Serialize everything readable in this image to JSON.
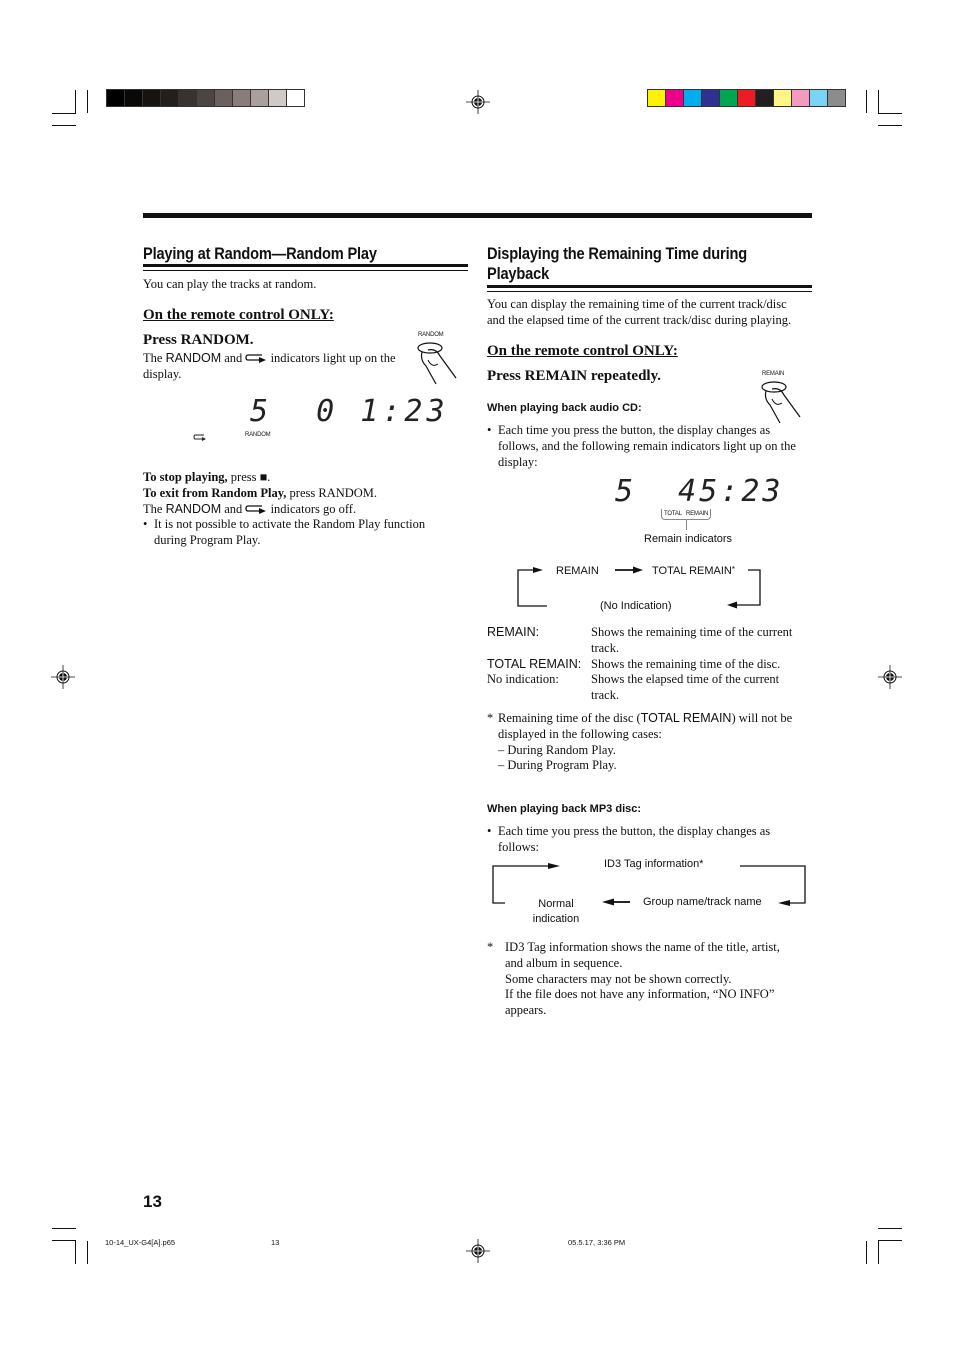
{
  "registration": {
    "grayscale_swatches": [
      "#000000",
      "#0b0908",
      "#161311",
      "#231f1c",
      "#3a3230",
      "#4d4544",
      "#6a605d",
      "#877d7b",
      "#a9a09e",
      "#d1c9c7",
      "#ffffff"
    ],
    "color_swatches": [
      "#fff200",
      "#ec008c",
      "#00aeef",
      "#2e3192",
      "#00a651",
      "#ed1c24",
      "#231f20",
      "#fff685",
      "#f49ac1",
      "#7dd3f7",
      "#8c8c8c"
    ]
  },
  "left": {
    "title": "Playing at Random—Random Play",
    "intro": "You can play the tracks at random.",
    "remote_heading": "On the remote control ONLY:",
    "step_title": "Press RANDOM.",
    "step_text_pre": "The ",
    "step_text_ind": "RANDOM",
    "step_text_mid": " and ",
    "step_text_post": " indicators light up on the",
    "step_text_line2": "display.",
    "button_label": "RANDOM",
    "lcd_text": "5  0 1:23",
    "lcd_indicator": "RANDOM",
    "stop_bold": "To stop playing,",
    "stop_rest": " press ■.",
    "exit_bold": "To exit from Random Play,",
    "exit_rest": " press RANDOM.",
    "off_pre": "The ",
    "off_ind": "RANDOM",
    "off_mid": " and ",
    "off_post": " indicators go off.",
    "bullet_line1": "It is not possible to activate the Random Play function",
    "bullet_line2": "during Program Play."
  },
  "right": {
    "title_line1": "Displaying the Remaining Time during",
    "title_line2": "Playback",
    "intro_line1": "You can display the remaining time of the current track/disc",
    "intro_line2": "and the elapsed time of the current track/disc during playing.",
    "remote_heading": "On the remote control ONLY:",
    "step_title": "Press REMAIN repeatedly.",
    "button_label": "REMAIN",
    "cd_heading": "When playing back audio CD:",
    "cd_bullet_line1": "Each time you press the button, the display changes as",
    "cd_bullet_line2": "follows, and the following remain indicators light up on the",
    "cd_bullet_line3": "display:",
    "lcd_text": "5  45:23",
    "lcd_ind_total": "TOTAL",
    "lcd_ind_remain": "REMAIN",
    "remain_indicators_label": "Remain indicators",
    "cycle": {
      "remain": "REMAIN",
      "total_remain": "TOTAL REMAIN",
      "asterisk": "*",
      "no_indication": "(No Indication)"
    },
    "definitions": [
      {
        "term": "REMAIN:",
        "line1": "Shows the remaining time of the current",
        "line2": "track."
      },
      {
        "term": "TOTAL REMAIN:",
        "line1": "Shows the remaining time of the disc.",
        "line2": ""
      },
      {
        "term": "No indication:",
        "line1": "Shows the elapsed time of the current",
        "line2": "track."
      }
    ],
    "note_star": "*",
    "note_line1_pre": "Remaining time of the disc (",
    "note_line1_ind": "TOTAL REMAIN",
    "note_line1_post": ") will not be",
    "note_line2": "displayed in the following cases:",
    "note_case1": "– During Random Play.",
    "note_case2": "– During Program Play.",
    "mp3_heading": "When playing back MP3 disc:",
    "mp3_bullet_line1": "Each time you press the button, the display changes as",
    "mp3_bullet_line2": "follows:",
    "mp3_cycle": {
      "id3": "ID3 Tag information*",
      "group": "Group name/track name",
      "normal_line1": "Normal",
      "normal_line2": "indication"
    },
    "mp3_note_star": "*",
    "mp3_note_lines": [
      "ID3 Tag information shows the name of the title, artist,",
      "and album in sequence.",
      "Some characters may not be shown correctly.",
      "If the file does not have any information, “NO INFO”",
      "appears."
    ]
  },
  "footer": {
    "page_number": "13",
    "file_name": "10-14_UX-G4[A].p65",
    "slug_page": "13",
    "timestamp": "05.5.17, 3:36 PM"
  }
}
